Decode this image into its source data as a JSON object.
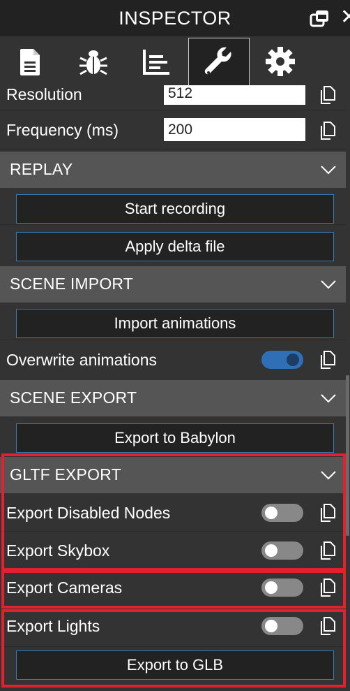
{
  "window": {
    "title": "INSPECTOR"
  },
  "tabs": [
    {
      "name": "properties",
      "icon": "document-icon",
      "active": false
    },
    {
      "name": "debug",
      "icon": "bug-icon",
      "active": false
    },
    {
      "name": "statistics",
      "icon": "chart-icon",
      "active": false
    },
    {
      "name": "tools",
      "icon": "wrench-icon",
      "active": true
    },
    {
      "name": "settings",
      "icon": "gear-icon",
      "active": false
    }
  ],
  "capture": {
    "resolution_label": "Resolution",
    "resolution_value": "512",
    "frequency_label": "Frequency (ms)",
    "frequency_value": "200"
  },
  "replay": {
    "title": "REPLAY",
    "start_recording": "Start recording",
    "apply_delta": "Apply delta file"
  },
  "scene_import": {
    "title": "SCENE IMPORT",
    "import_animations": "Import animations",
    "overwrite_label": "Overwrite animations",
    "overwrite_on": true
  },
  "scene_export": {
    "title": "SCENE EXPORT",
    "export_babylon": "Export to Babylon"
  },
  "gltf_export": {
    "title": "GLTF EXPORT",
    "disabled_nodes_label": "Export Disabled Nodes",
    "disabled_nodes_on": false,
    "skybox_label": "Export Skybox",
    "skybox_on": false,
    "cameras_label": "Export Cameras",
    "cameras_on": false,
    "lights_label": "Export Lights",
    "lights_on": false,
    "export_glb": "Export to GLB"
  },
  "colors": {
    "accent": "#2f6fb5",
    "button_border": "#337ab7",
    "highlight": "#e3202e",
    "section_header": "#555555"
  }
}
